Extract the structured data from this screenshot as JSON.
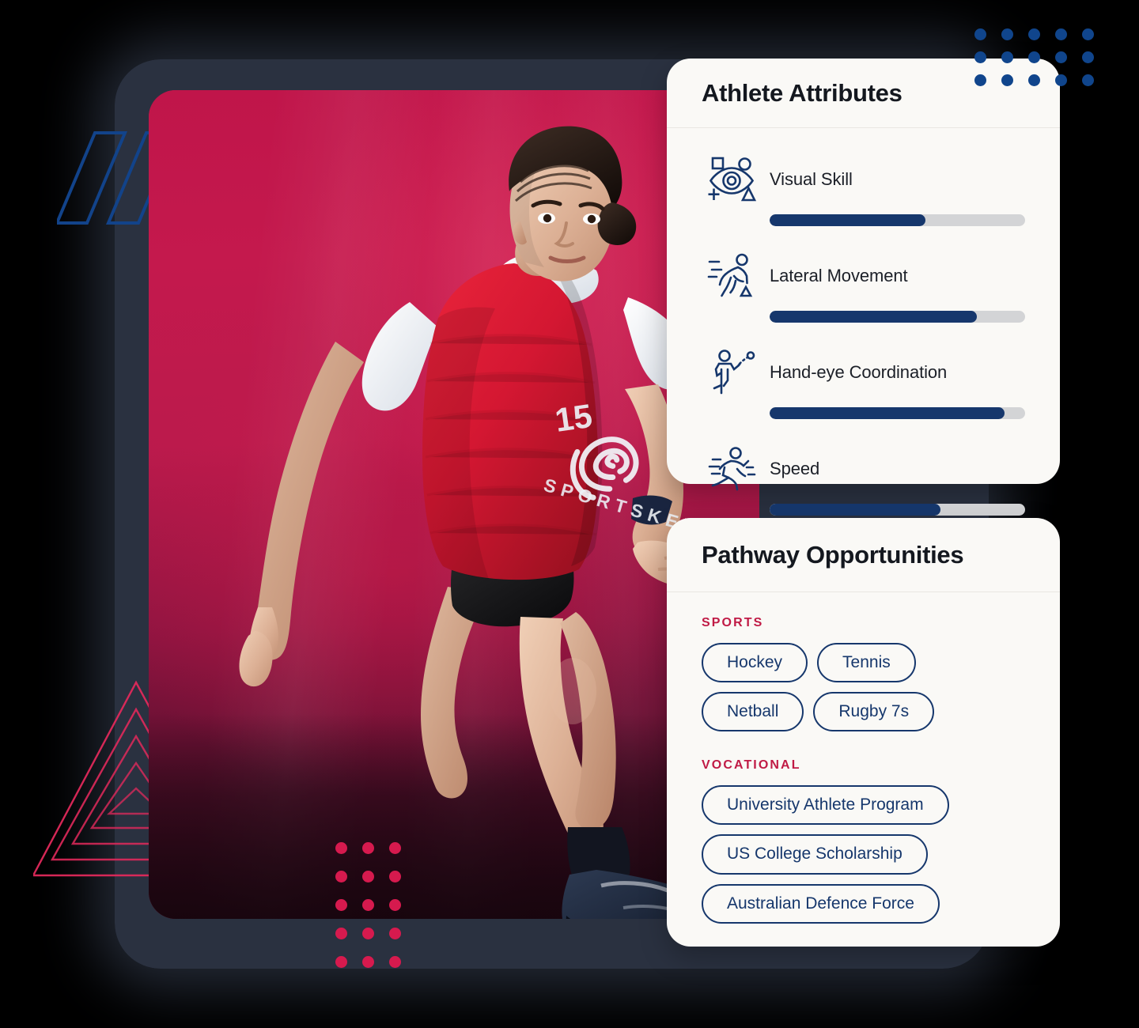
{
  "theme": {
    "background": "#000000",
    "shell": "#2a3140",
    "card_bg": "#faf9f6",
    "navy": "#16376c",
    "crimson": "#c01a45",
    "track": "#d3d4d6",
    "photo_red": "#c3164a",
    "dot_blue": "#10458c",
    "dot_pink": "#d61a4e"
  },
  "photo": {
    "alt": "Female athlete in red training bib sprinting on a track",
    "jersey_number": "15",
    "jersey_brand": "SPORTSKEY"
  },
  "attributes_card": {
    "title": "Athlete Attributes",
    "rows": [
      {
        "label": "Visual Skill",
        "icon": "eye-vision-icon",
        "value": 61
      },
      {
        "label": "Lateral Movement",
        "icon": "lateral-runner-icon",
        "value": 81
      },
      {
        "label": "Hand-eye Coordination",
        "icon": "catching-ball-icon",
        "value": 92
      },
      {
        "label": "Speed",
        "icon": "sprinting-runner-icon",
        "value": 67
      }
    ]
  },
  "pathways_card": {
    "title": "Pathway Opportunities",
    "groups": [
      {
        "label": "SPORTS",
        "chips": [
          "Hockey",
          "Tennis",
          "Netball",
          "Rugby 7s"
        ]
      },
      {
        "label": "VOCATIONAL",
        "chips": [
          "University Athlete Program",
          "US College Scholarship",
          "Australian Defence Force"
        ]
      }
    ]
  },
  "decorations": {
    "blue_parallelograms": 3,
    "red_triangles": 5,
    "blue_dot_grid": {
      "cols": 5,
      "rows": 3
    },
    "pink_dot_grid": {
      "cols": 3,
      "rows": 5
    }
  }
}
